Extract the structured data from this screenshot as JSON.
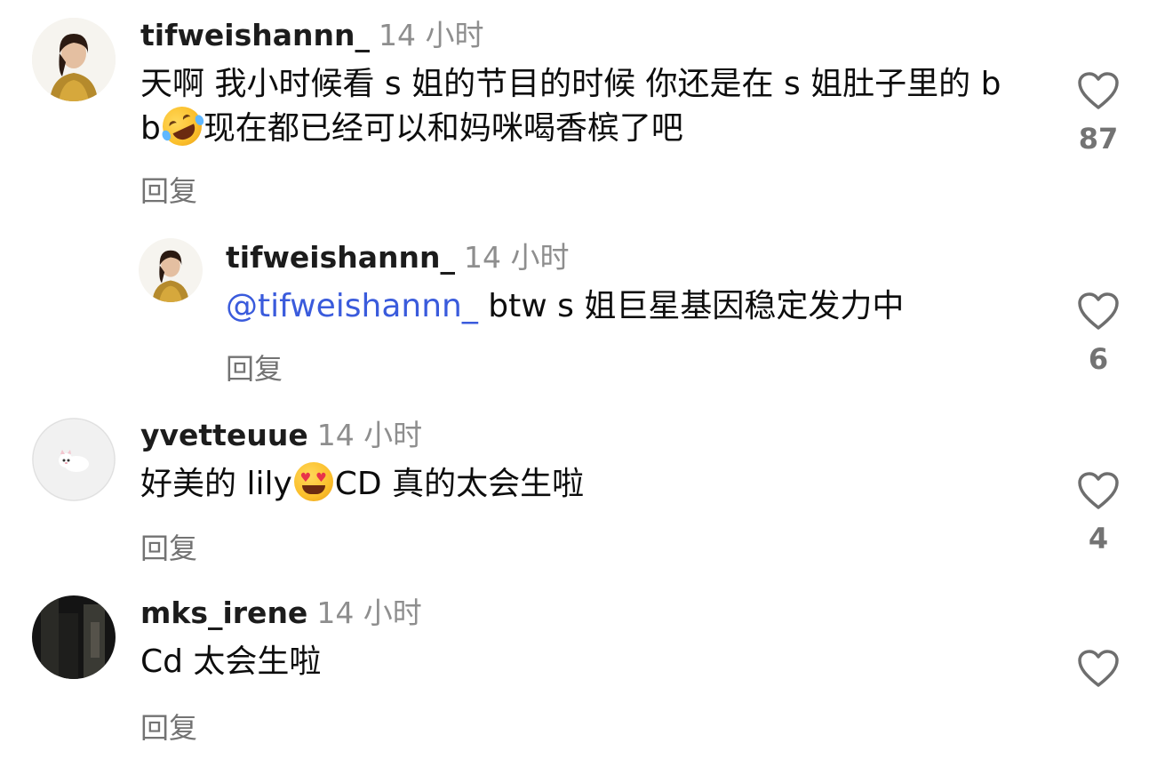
{
  "comments": [
    {
      "username": "tifweishannn_",
      "time": "14 小时",
      "text_before_emoji": "天啊 我小时候看 s 姐的节目的时候 你还是在 s 姐肚子里的 bb",
      "emoji": "rolling-on-floor-laughing-emoji",
      "text_after_emoji": "现在都已经可以和妈咪喝香槟了吧",
      "reply_label": "回复",
      "likes": "87"
    },
    {
      "username": "tifweishannn_",
      "time": "14 小时",
      "mention": "@tifweishannn_",
      "text": " btw s 姐巨星基因稳定发力中",
      "reply_label": "回复",
      "likes": "6"
    },
    {
      "username": "yvetteuue",
      "time": "14 小时",
      "text_before_emoji": "好美的 lily",
      "emoji": "heart-eyes-emoji",
      "text_after_emoji": "CD 真的太会生啦",
      "reply_label": "回复",
      "likes": "4"
    },
    {
      "username": "mks_irene",
      "time": "14 小时",
      "text": "Cd 太会生啦",
      "reply_label": "回复",
      "likes": ""
    }
  ],
  "colors": {
    "username": "#1c1c1c",
    "meta": "#8e8e8e",
    "mention": "#3a5bdc",
    "heart_outline": "#6e6e6e"
  }
}
